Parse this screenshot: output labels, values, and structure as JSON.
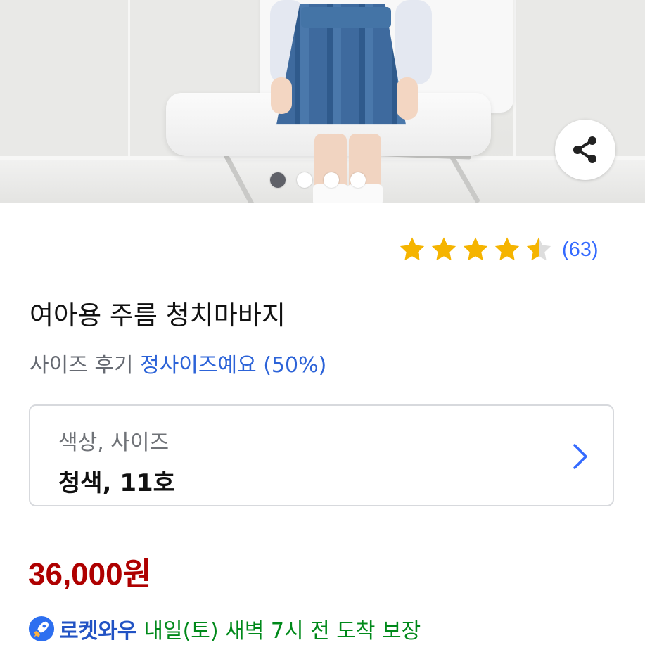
{
  "product_image": {
    "alt": "girl wearing denim pleated skirt-pants sitting on white chair",
    "carousel": {
      "total": 4,
      "active_index": 0
    }
  },
  "share": {
    "icon": "share-icon"
  },
  "rating": {
    "value": 4.5,
    "max": 5,
    "count_label": "(63)",
    "star_color": "#f5b400",
    "empty_star_color": "#dddddd"
  },
  "product": {
    "title": "여아용 주름 청치마바지",
    "size_review_label": "사이즈 후기",
    "size_review_value": "정사이즈예요 (50%)"
  },
  "option": {
    "label": "색상, 사이즈",
    "value": "청색, 11호",
    "icon": "chevron-right-icon"
  },
  "price": {
    "amount": "36,000원",
    "color": "#ae0000"
  },
  "delivery": {
    "icon": "rocket-icon",
    "brand": "로켓와우",
    "message": "내일(토) 새벽 7시 전 도착 보장",
    "brand_color": "#2253c4",
    "message_color": "#00891a"
  }
}
